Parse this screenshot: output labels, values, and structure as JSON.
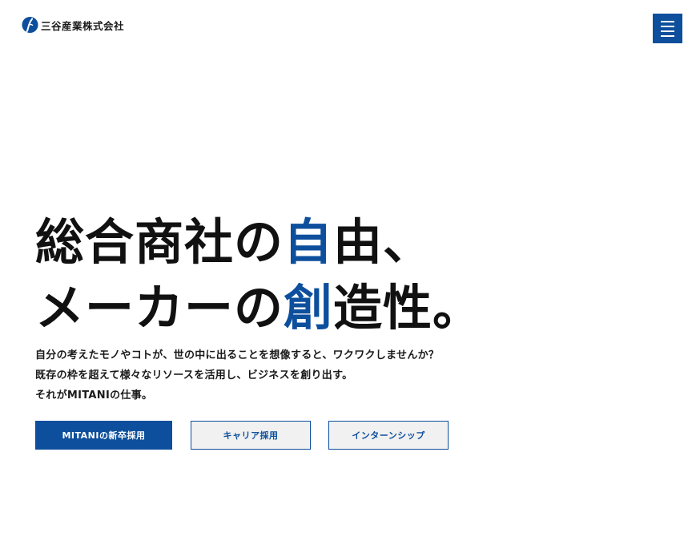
{
  "header": {
    "logo_text": "三谷産業株式会社",
    "menu_icon": "hamburger-menu-icon"
  },
  "hero": {
    "headline_line1_pre": "総合商社の",
    "headline_line1_accent": "自",
    "headline_line1_post": "由、",
    "headline_line2_pre": "メーカーの",
    "headline_line2_accent": "創",
    "headline_line2_post": "造性。",
    "lead_lines": [
      "自分の考えたモノやコトが、世の中に出ることを想像すると、ワクワクしませんか？",
      "既存の枠を超えて様々なリソースを活用し、ビジネスを創り出す。",
      "それがMITANIの仕事。"
    ]
  },
  "buttons": {
    "new_grad": "MITANIの新卒採用",
    "career": "キャリア採用",
    "internship": "インターンシップ"
  },
  "colors": {
    "brand": "#0d4f9c",
    "text": "#111111",
    "secondary_button_bg": "#f1f1f1"
  }
}
